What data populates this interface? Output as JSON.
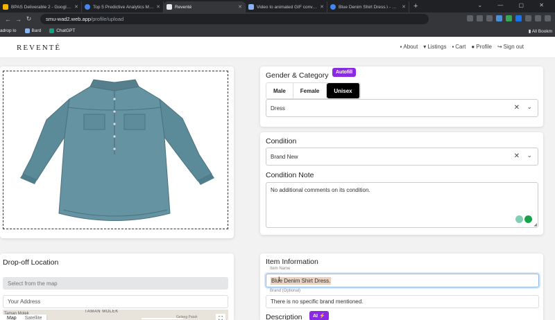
{
  "browser": {
    "tabs": [
      {
        "title": "BPAS Deliverable 2 - Google Sli",
        "color": "#f4b400",
        "active": false
      },
      {
        "title": "Top 5 Predictive Analytics Mode",
        "color": "#4285f4",
        "active": false
      },
      {
        "title": "Reventé",
        "color": "#e8eaed",
        "active": true
      },
      {
        "title": "Video to animated GIF converte",
        "color": "#8ab4f8",
        "active": false
      },
      {
        "title": "Blue Denim Shirt Dress.\\ - Goog",
        "color": "#4285f4",
        "active": false
      }
    ],
    "url_domain": "smu-wad2.web.app",
    "url_path": "/profile/upload",
    "bookmarks": [
      "adrop lo",
      "Bard",
      "ChatGPT"
    ],
    "all_bookmarks": "All Bookm"
  },
  "site": {
    "logo": "REVENTÉ",
    "nav": [
      {
        "icon": "book-icon",
        "label": "About"
      },
      {
        "icon": "shirt-icon",
        "label": "Listings"
      },
      {
        "icon": "bag-icon",
        "label": "Cart"
      },
      {
        "icon": "user-icon",
        "label": "Profile"
      },
      {
        "icon": "signout-icon",
        "label": "Sign out"
      }
    ]
  },
  "gender_category": {
    "title": "Gender & Category",
    "badge": "Autofill",
    "genders": [
      "Male",
      "Female",
      "Unisex"
    ],
    "selected_gender": "Unisex",
    "category_value": "Dress"
  },
  "condition": {
    "title": "Condition",
    "value": "Brand New",
    "note_title": "Condition Note",
    "note_value": "No additional comments on its condition."
  },
  "dropoff": {
    "title": "Drop-off Location",
    "select_placeholder": "Select from the map",
    "address_placeholder": "Your Address",
    "map_label": "TAMAN MOLEK",
    "map_label2": "Taman Molek",
    "map_road": "Gelang Patah",
    "map_tabs": [
      "Map",
      "Satellite"
    ]
  },
  "item_info": {
    "title": "Item Information",
    "name_label": "Item Name",
    "name_value": "Blue Denim Shirt Dress.",
    "brand_label": "Brand (Optional)",
    "brand_value": "There is no specific brand mentioned.",
    "description_title": "Description",
    "ai_badge": "AI ⚡"
  },
  "colors": {
    "accent": "#8a2be2",
    "denim": "#5b8a99"
  }
}
